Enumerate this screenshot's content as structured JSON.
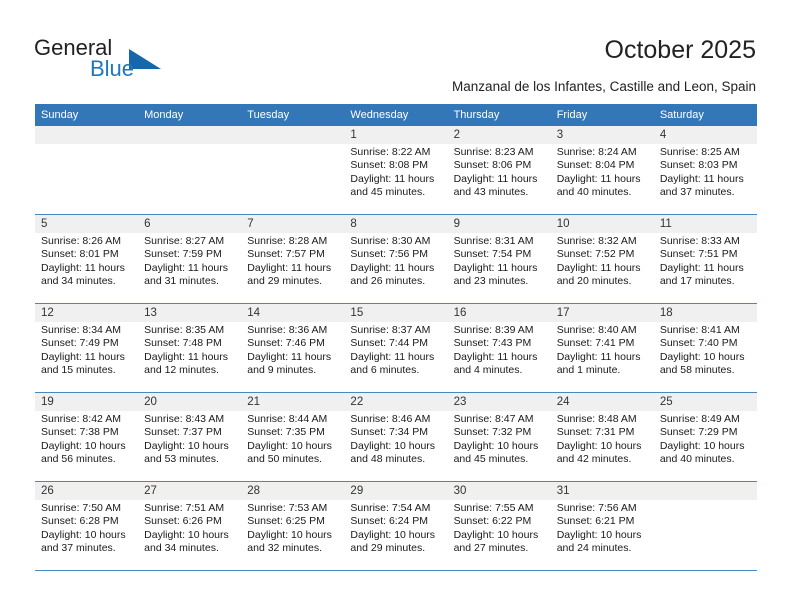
{
  "brand": {
    "name_part1": "General",
    "name_part2": "Blue",
    "triangle_icon": "triangle-logo-icon",
    "accent_color": "#1566ab",
    "text_color": "#1f77bd"
  },
  "header": {
    "title": "October 2025",
    "subtitle": "Manzanal de los Infantes, Castille and Leon, Spain"
  },
  "theme": {
    "header_row_bg": "#3377b8",
    "header_row_text": "#ffffff",
    "daynum_band_bg": "#f0f0f0",
    "row_divider": "#4a87bd"
  },
  "weekday_headers": [
    "Sunday",
    "Monday",
    "Tuesday",
    "Wednesday",
    "Thursday",
    "Friday",
    "Saturday"
  ],
  "weeks": [
    [
      {
        "day": "",
        "sunrise": "",
        "sunset": "",
        "daylight_line1": "",
        "daylight_line2": ""
      },
      {
        "day": "",
        "sunrise": "",
        "sunset": "",
        "daylight_line1": "",
        "daylight_line2": ""
      },
      {
        "day": "",
        "sunrise": "",
        "sunset": "",
        "daylight_line1": "",
        "daylight_line2": ""
      },
      {
        "day": "1",
        "sunrise": "Sunrise: 8:22 AM",
        "sunset": "Sunset: 8:08 PM",
        "daylight_line1": "Daylight: 11 hours",
        "daylight_line2": "and 45 minutes."
      },
      {
        "day": "2",
        "sunrise": "Sunrise: 8:23 AM",
        "sunset": "Sunset: 8:06 PM",
        "daylight_line1": "Daylight: 11 hours",
        "daylight_line2": "and 43 minutes."
      },
      {
        "day": "3",
        "sunrise": "Sunrise: 8:24 AM",
        "sunset": "Sunset: 8:04 PM",
        "daylight_line1": "Daylight: 11 hours",
        "daylight_line2": "and 40 minutes."
      },
      {
        "day": "4",
        "sunrise": "Sunrise: 8:25 AM",
        "sunset": "Sunset: 8:03 PM",
        "daylight_line1": "Daylight: 11 hours",
        "daylight_line2": "and 37 minutes."
      }
    ],
    [
      {
        "day": "5",
        "sunrise": "Sunrise: 8:26 AM",
        "sunset": "Sunset: 8:01 PM",
        "daylight_line1": "Daylight: 11 hours",
        "daylight_line2": "and 34 minutes."
      },
      {
        "day": "6",
        "sunrise": "Sunrise: 8:27 AM",
        "sunset": "Sunset: 7:59 PM",
        "daylight_line1": "Daylight: 11 hours",
        "daylight_line2": "and 31 minutes."
      },
      {
        "day": "7",
        "sunrise": "Sunrise: 8:28 AM",
        "sunset": "Sunset: 7:57 PM",
        "daylight_line1": "Daylight: 11 hours",
        "daylight_line2": "and 29 minutes."
      },
      {
        "day": "8",
        "sunrise": "Sunrise: 8:30 AM",
        "sunset": "Sunset: 7:56 PM",
        "daylight_line1": "Daylight: 11 hours",
        "daylight_line2": "and 26 minutes."
      },
      {
        "day": "9",
        "sunrise": "Sunrise: 8:31 AM",
        "sunset": "Sunset: 7:54 PM",
        "daylight_line1": "Daylight: 11 hours",
        "daylight_line2": "and 23 minutes."
      },
      {
        "day": "10",
        "sunrise": "Sunrise: 8:32 AM",
        "sunset": "Sunset: 7:52 PM",
        "daylight_line1": "Daylight: 11 hours",
        "daylight_line2": "and 20 minutes."
      },
      {
        "day": "11",
        "sunrise": "Sunrise: 8:33 AM",
        "sunset": "Sunset: 7:51 PM",
        "daylight_line1": "Daylight: 11 hours",
        "daylight_line2": "and 17 minutes."
      }
    ],
    [
      {
        "day": "12",
        "sunrise": "Sunrise: 8:34 AM",
        "sunset": "Sunset: 7:49 PM",
        "daylight_line1": "Daylight: 11 hours",
        "daylight_line2": "and 15 minutes."
      },
      {
        "day": "13",
        "sunrise": "Sunrise: 8:35 AM",
        "sunset": "Sunset: 7:48 PM",
        "daylight_line1": "Daylight: 11 hours",
        "daylight_line2": "and 12 minutes."
      },
      {
        "day": "14",
        "sunrise": "Sunrise: 8:36 AM",
        "sunset": "Sunset: 7:46 PM",
        "daylight_line1": "Daylight: 11 hours",
        "daylight_line2": "and 9 minutes."
      },
      {
        "day": "15",
        "sunrise": "Sunrise: 8:37 AM",
        "sunset": "Sunset: 7:44 PM",
        "daylight_line1": "Daylight: 11 hours",
        "daylight_line2": "and 6 minutes."
      },
      {
        "day": "16",
        "sunrise": "Sunrise: 8:39 AM",
        "sunset": "Sunset: 7:43 PM",
        "daylight_line1": "Daylight: 11 hours",
        "daylight_line2": "and 4 minutes."
      },
      {
        "day": "17",
        "sunrise": "Sunrise: 8:40 AM",
        "sunset": "Sunset: 7:41 PM",
        "daylight_line1": "Daylight: 11 hours",
        "daylight_line2": "and 1 minute."
      },
      {
        "day": "18",
        "sunrise": "Sunrise: 8:41 AM",
        "sunset": "Sunset: 7:40 PM",
        "daylight_line1": "Daylight: 10 hours",
        "daylight_line2": "and 58 minutes."
      }
    ],
    [
      {
        "day": "19",
        "sunrise": "Sunrise: 8:42 AM",
        "sunset": "Sunset: 7:38 PM",
        "daylight_line1": "Daylight: 10 hours",
        "daylight_line2": "and 56 minutes."
      },
      {
        "day": "20",
        "sunrise": "Sunrise: 8:43 AM",
        "sunset": "Sunset: 7:37 PM",
        "daylight_line1": "Daylight: 10 hours",
        "daylight_line2": "and 53 minutes."
      },
      {
        "day": "21",
        "sunrise": "Sunrise: 8:44 AM",
        "sunset": "Sunset: 7:35 PM",
        "daylight_line1": "Daylight: 10 hours",
        "daylight_line2": "and 50 minutes."
      },
      {
        "day": "22",
        "sunrise": "Sunrise: 8:46 AM",
        "sunset": "Sunset: 7:34 PM",
        "daylight_line1": "Daylight: 10 hours",
        "daylight_line2": "and 48 minutes."
      },
      {
        "day": "23",
        "sunrise": "Sunrise: 8:47 AM",
        "sunset": "Sunset: 7:32 PM",
        "daylight_line1": "Daylight: 10 hours",
        "daylight_line2": "and 45 minutes."
      },
      {
        "day": "24",
        "sunrise": "Sunrise: 8:48 AM",
        "sunset": "Sunset: 7:31 PM",
        "daylight_line1": "Daylight: 10 hours",
        "daylight_line2": "and 42 minutes."
      },
      {
        "day": "25",
        "sunrise": "Sunrise: 8:49 AM",
        "sunset": "Sunset: 7:29 PM",
        "daylight_line1": "Daylight: 10 hours",
        "daylight_line2": "and 40 minutes."
      }
    ],
    [
      {
        "day": "26",
        "sunrise": "Sunrise: 7:50 AM",
        "sunset": "Sunset: 6:28 PM",
        "daylight_line1": "Daylight: 10 hours",
        "daylight_line2": "and 37 minutes."
      },
      {
        "day": "27",
        "sunrise": "Sunrise: 7:51 AM",
        "sunset": "Sunset: 6:26 PM",
        "daylight_line1": "Daylight: 10 hours",
        "daylight_line2": "and 34 minutes."
      },
      {
        "day": "28",
        "sunrise": "Sunrise: 7:53 AM",
        "sunset": "Sunset: 6:25 PM",
        "daylight_line1": "Daylight: 10 hours",
        "daylight_line2": "and 32 minutes."
      },
      {
        "day": "29",
        "sunrise": "Sunrise: 7:54 AM",
        "sunset": "Sunset: 6:24 PM",
        "daylight_line1": "Daylight: 10 hours",
        "daylight_line2": "and 29 minutes."
      },
      {
        "day": "30",
        "sunrise": "Sunrise: 7:55 AM",
        "sunset": "Sunset: 6:22 PM",
        "daylight_line1": "Daylight: 10 hours",
        "daylight_line2": "and 27 minutes."
      },
      {
        "day": "31",
        "sunrise": "Sunrise: 7:56 AM",
        "sunset": "Sunset: 6:21 PM",
        "daylight_line1": "Daylight: 10 hours",
        "daylight_line2": "and 24 minutes."
      },
      {
        "day": "",
        "sunrise": "",
        "sunset": "",
        "daylight_line1": "",
        "daylight_line2": ""
      }
    ]
  ]
}
